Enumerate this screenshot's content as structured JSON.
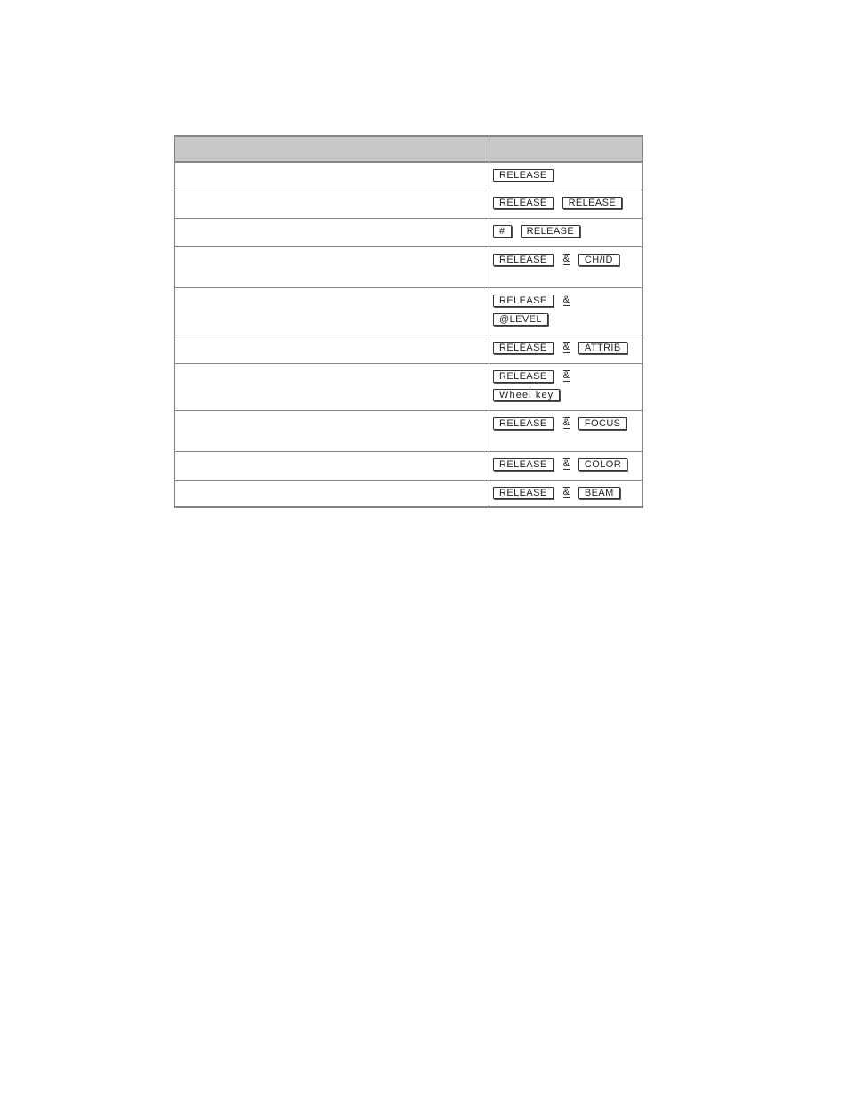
{
  "table": {
    "headers": [
      "",
      ""
    ],
    "rows": [
      {
        "description": "",
        "keys": [
          [
            "RELEASE"
          ]
        ],
        "connectors": [
          []
        ]
      },
      {
        "description": "",
        "keys": [
          [
            "RELEASE",
            "RELEASE"
          ]
        ],
        "connectors": [
          [
            ""
          ]
        ]
      },
      {
        "description": "",
        "keys": [
          [
            "#",
            "RELEASE"
          ]
        ],
        "connectors": [
          [
            ""
          ]
        ]
      },
      {
        "description": "",
        "keys": [
          [
            "RELEASE",
            "CH/ID"
          ]
        ],
        "connectors": [
          [
            "&"
          ]
        ]
      },
      {
        "description": "",
        "keys": [
          [
            "RELEASE"
          ],
          [
            "@LEVEL"
          ]
        ],
        "connectors": [
          [
            "&"
          ],
          []
        ]
      },
      {
        "description": "",
        "keys": [
          [
            "RELEASE",
            "ATTRIB"
          ]
        ],
        "connectors": [
          [
            "&"
          ]
        ]
      },
      {
        "description": "",
        "keys": [
          [
            "RELEASE"
          ],
          [
            "Wheel key"
          ]
        ],
        "connectors": [
          [
            "&"
          ],
          []
        ]
      },
      {
        "description": "",
        "keys": [
          [
            "RELEASE",
            "FOCUS"
          ]
        ],
        "connectors": [
          [
            "&"
          ]
        ]
      },
      {
        "description": "",
        "keys": [
          [
            "RELEASE",
            "COLOR"
          ]
        ],
        "connectors": [
          [
            "&"
          ]
        ]
      },
      {
        "description": "",
        "keys": [
          [
            "RELEASE",
            "BEAM"
          ]
        ],
        "connectors": [
          [
            "&"
          ]
        ]
      }
    ]
  }
}
